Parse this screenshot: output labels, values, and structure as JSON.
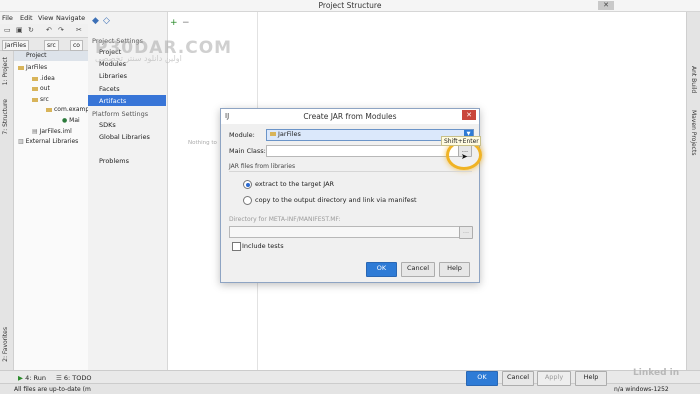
{
  "window": {
    "title": "Project Structure",
    "close_label": "✕"
  },
  "ide": {
    "menu": [
      "File",
      "Edit",
      "View",
      "Navigate"
    ],
    "breadcrumbs": [
      "JarFiles",
      "src",
      "co"
    ],
    "project_header": "Project",
    "tree": [
      {
        "label": "JarFiles",
        "indent": 0,
        "kind": "folder"
      },
      {
        "label": ".idea",
        "indent": 1,
        "kind": "folder"
      },
      {
        "label": "out",
        "indent": 1,
        "kind": "folder"
      },
      {
        "label": "src",
        "indent": 1,
        "kind": "folder"
      },
      {
        "label": "com.examp",
        "indent": 2,
        "kind": "folder"
      },
      {
        "label": "Mai",
        "indent": 3,
        "kind": "class"
      },
      {
        "label": "JarFiles.iml",
        "indent": 1,
        "kind": "file"
      },
      {
        "label": "External Libraries",
        "indent": 0,
        "kind": "folder"
      }
    ],
    "left_tabs": [
      "1: Project",
      "7: Structure",
      "2: Favorites"
    ],
    "right_tabs": [
      "Ant Build",
      "Maven Projects"
    ],
    "bottom_tabs": [
      "4: Run",
      "6: TODO"
    ],
    "status_text": "All files are up-to-date (m",
    "status_right": "n/a  windows-1252",
    "brand": "Linked in"
  },
  "watermark": {
    "line1": "P30DAR.COM",
    "line2": "اولین دانلود سنتر تخصصی"
  },
  "project_settings": {
    "section1": "Project Settings",
    "items1": [
      "Project",
      "Modules",
      "Libraries",
      "Facets",
      "Artifacts"
    ],
    "section2": "Platform Settings",
    "items2": [
      "SDKs",
      "Global Libraries"
    ],
    "problems": "Problems",
    "selected": "Artifacts",
    "middle_hint": "Nothing to"
  },
  "footer_buttons": {
    "ok": "OK",
    "cancel": "Cancel",
    "apply": "Apply",
    "help": "Help"
  },
  "dialog": {
    "title": "Create JAR from Modules",
    "module_label": "Module:",
    "module_value": "JarFiles",
    "main_class_label": "Main Class:",
    "main_class_value": "",
    "browse_label": "...",
    "tooltip": "Shift+Enter",
    "group_label": "JAR files from libraries",
    "radio_extract": "extract to the target JAR",
    "radio_copy": "copy to the output directory and link via manifest",
    "selected_radio": "extract",
    "manifest_label": "Directory for META-INF/MANIFEST.MF:",
    "manifest_value": "",
    "include_tests": "Include tests",
    "include_tests_checked": false,
    "ok": "OK",
    "cancel": "Cancel",
    "help": "Help"
  },
  "colors": {
    "accent": "#3875d7",
    "highlight": "#f0b324",
    "close_red": "#c9473d"
  }
}
